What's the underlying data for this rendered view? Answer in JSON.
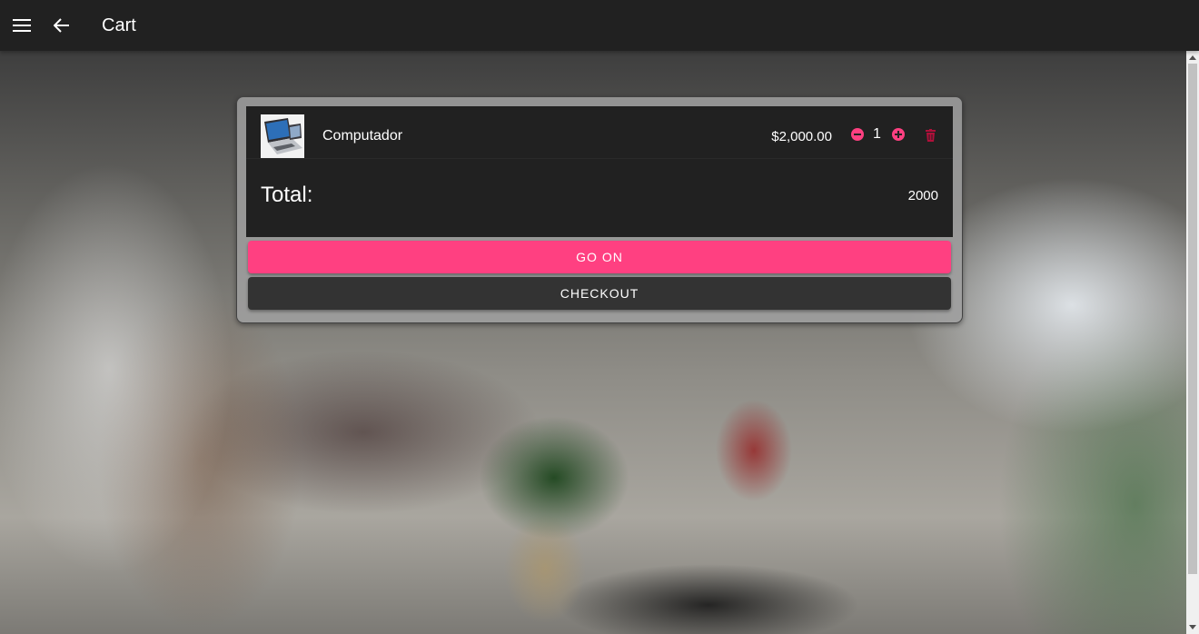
{
  "toolbar": {
    "menu_icon": "menu-icon",
    "back_icon": "arrow-back-icon",
    "title": "Cart"
  },
  "cart": {
    "items": [
      {
        "name": "Computador",
        "price": "$2,000.00",
        "quantity": "1",
        "image": "laptop-product-image"
      }
    ],
    "total_label": "Total:",
    "total_value": "2000"
  },
  "actions": {
    "go_on_label": "GO ON",
    "checkout_label": "CHECKOUT"
  },
  "colors": {
    "accent": "#ff4081",
    "toolbar": "#212121",
    "card": "#212121",
    "checkout_button": "#333333"
  }
}
